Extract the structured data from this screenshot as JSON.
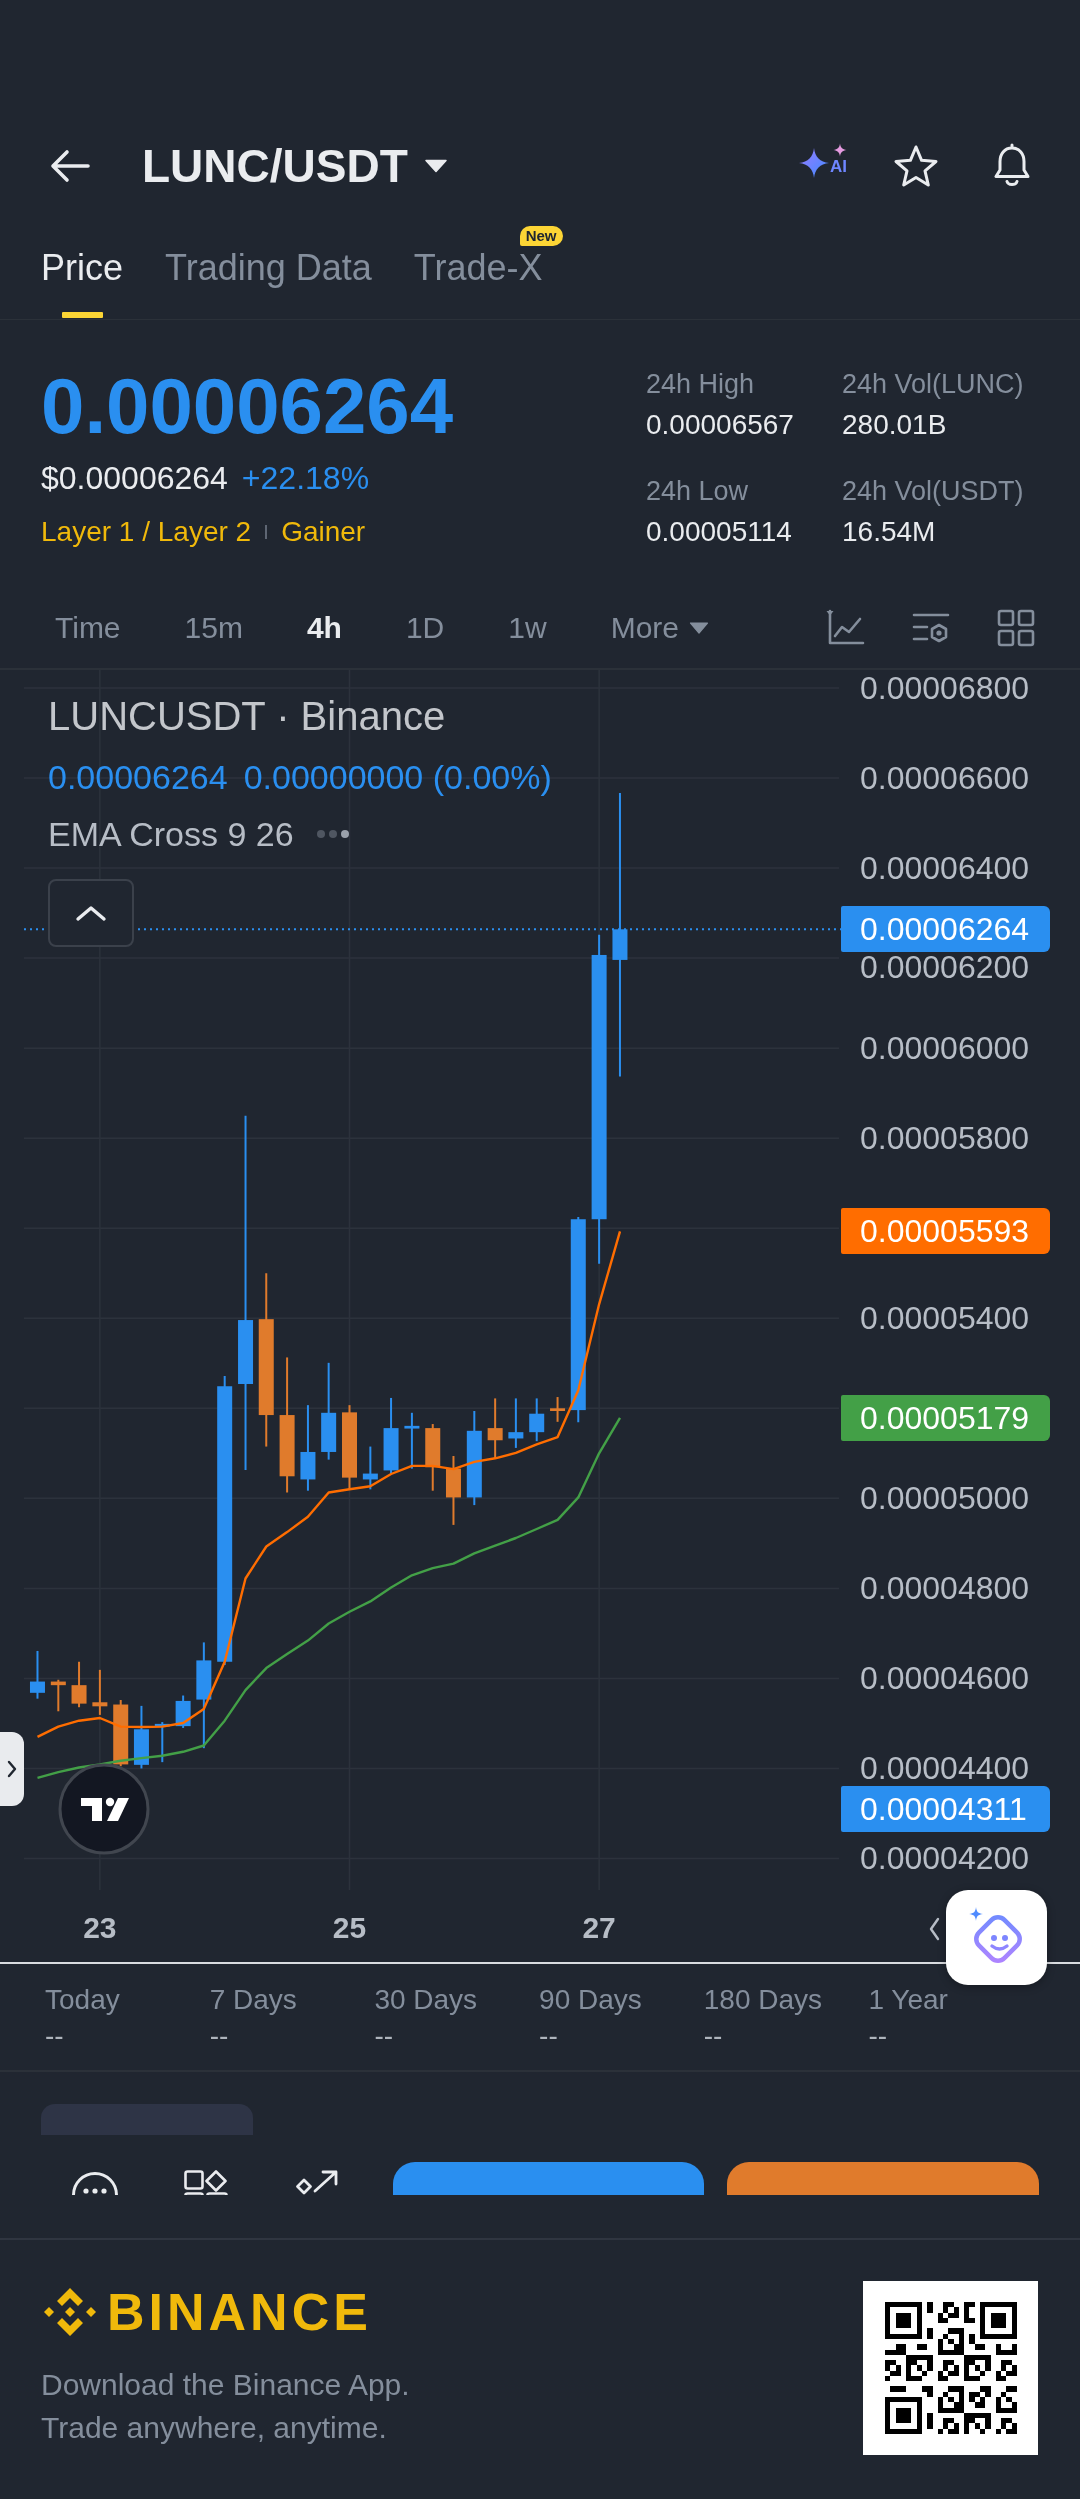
{
  "header": {
    "title": "LUNC/USDT",
    "ai_label": "AI"
  },
  "tabs": [
    {
      "label": "Price",
      "selected": true
    },
    {
      "label": "Trading Data",
      "selected": false
    },
    {
      "label": "Trade-X",
      "selected": false,
      "badge": "New"
    }
  ],
  "ticker": {
    "price": "0.00006264",
    "usd_price": "$0.00006264",
    "change": "+22.18%",
    "tags": [
      "Layer 1 / Layer 2",
      "Gainer"
    ],
    "stats": [
      {
        "label": "24h High",
        "value": "0.00006567"
      },
      {
        "label": "24h Vol(LUNC)",
        "value": "280.01B"
      },
      {
        "label": "24h Low",
        "value": "0.00005114"
      },
      {
        "label": "24h Vol(USDT)",
        "value": "16.54M"
      }
    ]
  },
  "intervals": [
    {
      "label": "Time",
      "kind": "option",
      "selected": false
    },
    {
      "label": "15m",
      "kind": "option",
      "selected": false
    },
    {
      "label": "4h",
      "kind": "option",
      "selected": true
    },
    {
      "label": "1D",
      "kind": "option",
      "selected": false
    },
    {
      "label": "1w",
      "kind": "option",
      "selected": false
    },
    {
      "label": "More",
      "kind": "menu",
      "selected": false
    }
  ],
  "chart": {
    "legend": {
      "symbol": "LUNCUSDT · Binance",
      "price": "0.00006264",
      "change": "0.00000000 (0.00%)",
      "indicator": "EMA Cross 9 26"
    },
    "chart_data": {
      "type": "candlestick",
      "x": [
        22.5,
        22.667,
        22.833,
        23,
        23.167,
        23.333,
        23.5,
        23.667,
        23.833,
        24,
        24.167,
        24.333,
        24.5,
        24.667,
        24.833,
        25,
        25.167,
        25.333,
        25.5,
        25.667,
        25.833,
        26,
        26.167,
        26.333,
        26.5,
        26.667,
        26.833,
        27,
        27.167
      ],
      "ohlc": [
        [
          4.568e-05,
          4.661e-05,
          4.555e-05,
          4.593e-05
        ],
        [
          4.593e-05,
          4.597e-05,
          4.527e-05,
          4.585e-05
        ],
        [
          4.585e-05,
          4.637e-05,
          4.536e-05,
          4.544e-05
        ],
        [
          4.547e-05,
          4.619e-05,
          4.519e-05,
          4.538e-05
        ],
        [
          4.542e-05,
          4.552e-05,
          4.405e-05,
          4.409e-05
        ],
        [
          4.408e-05,
          4.539e-05,
          4.4e-05,
          4.487e-05
        ],
        [
          4.493e-05,
          4.503e-05,
          4.414e-05,
          4.499e-05
        ],
        [
          4.494e-05,
          4.562e-05,
          4.49e-05,
          4.55e-05
        ],
        [
          4.553e-05,
          4.68e-05,
          4.445e-05,
          4.64e-05
        ],
        [
          4.637e-05,
          5.272e-05,
          4.63e-05,
          5.249e-05
        ],
        [
          5.254e-05,
          5.85e-05,
          5.063e-05,
          5.396e-05
        ],
        [
          5.398e-05,
          5.5e-05,
          5.115e-05,
          5.185e-05
        ],
        [
          5.185e-05,
          5.313e-05,
          5.013e-05,
          5.049e-05
        ],
        [
          5.042e-05,
          5.207e-05,
          5.017e-05,
          5.103e-05
        ],
        [
          5.103e-05,
          5.301e-05,
          5.086e-05,
          5.19e-05
        ],
        [
          5.191e-05,
          5.207e-05,
          5.02e-05,
          5.046e-05
        ],
        [
          5.042e-05,
          5.115e-05,
          5.02e-05,
          5.055e-05
        ],
        [
          5.062e-05,
          5.223e-05,
          5.055e-05,
          5.156e-05
        ],
        [
          5.155e-05,
          5.19e-05,
          5.066e-05,
          5.161e-05
        ],
        [
          5.156e-05,
          5.165e-05,
          5.017e-05,
          5.069e-05
        ],
        [
          5.066e-05,
          5.094e-05,
          4.941e-05,
          5.002e-05
        ],
        [
          5.002e-05,
          5.194e-05,
          4.985e-05,
          5.15e-05
        ],
        [
          5.156e-05,
          5.222e-05,
          5.089e-05,
          5.129e-05
        ],
        [
          5.133e-05,
          5.222e-05,
          5.112e-05,
          5.147e-05
        ],
        [
          5.147e-05,
          5.222e-05,
          5.127e-05,
          5.188e-05
        ],
        [
          5.2e-05,
          5.225e-05,
          5.17e-05,
          5.194e-05
        ],
        [
          5.196e-05,
          5.625e-05,
          5.169e-05,
          5.62e-05
        ],
        [
          5.62e-05,
          6.252e-05,
          5.521e-05,
          6.207e-05
        ],
        [
          6.196e-05,
          6.567e-05,
          5.937e-05,
          6.264e-05
        ]
      ],
      "xlim": [
        22.392,
        28.922
      ],
      "ylim": [
        4.13e-05,
        6.84e-05
      ],
      "grid": true,
      "xticks": [
        23,
        25,
        27
      ],
      "yticks": [
        {
          "value": 6.8e-05,
          "label": "0.00006800"
        },
        {
          "value": 6.6e-05,
          "label": "0.00006600"
        },
        {
          "value": 6.4e-05,
          "label": "0.00006400"
        },
        {
          "value": 6.2e-05,
          "label": "0.00006200"
        },
        {
          "value": 6e-05,
          "label": "0.00006000"
        },
        {
          "value": 5.8e-05,
          "label": "0.00005800"
        },
        {
          "value": 5.4e-05,
          "label": "0.00005400"
        },
        {
          "value": 5e-05,
          "label": "0.00005000"
        },
        {
          "value": 4.8e-05,
          "label": "0.00004800"
        },
        {
          "value": 4.6e-05,
          "label": "0.00004600"
        },
        {
          "value": 4.4e-05,
          "label": "0.00004400"
        },
        {
          "value": 4.2e-05,
          "label": "0.00004200"
        }
      ],
      "series": [
        {
          "type": "line",
          "color": "#ff6d00",
          "values": [
            4.47e-05,
            4.493e-05,
            4.506e-05,
            4.512e-05,
            4.493e-05,
            4.492e-05,
            4.493e-05,
            4.501e-05,
            4.532e-05,
            4.637e-05,
            4.822e-05,
            4.893e-05,
            4.925e-05,
            4.959e-05,
            5.013e-05,
            5.02e-05,
            5.027e-05,
            5.054e-05,
            5.072e-05,
            5.072e-05,
            5.065e-05,
            5.081e-05,
            5.089e-05,
            5.101e-05,
            5.12e-05,
            5.136e-05,
            5.24e-05,
            5.431e-05,
            5.593e-05
          ]
        },
        {
          "type": "line",
          "color": "#43a047",
          "values": [
            4.379e-05,
            4.392e-05,
            4.402e-05,
            4.409e-05,
            4.417e-05,
            4.423e-05,
            4.428e-05,
            4.437e-05,
            4.451e-05,
            4.506e-05,
            4.574e-05,
            4.623e-05,
            4.654e-05,
            4.684e-05,
            4.722e-05,
            4.748e-05,
            4.771e-05,
            4.802e-05,
            4.829e-05,
            4.845e-05,
            4.855e-05,
            4.878e-05,
            4.895e-05,
            4.912e-05,
            4.932e-05,
            4.952e-05,
            5.002e-05,
            5.1e-05,
            5.179e-05
          ]
        }
      ],
      "ref_lines": [
        {
          "axis": "y",
          "value": 6.264e-05,
          "label": "0.00006264"
        }
      ],
      "annotations": [
        "0.00005593",
        "0.00005179"
      ]
    },
    "price_marker": "0.00004311"
  },
  "periods": [
    {
      "label": "Today",
      "value": "--"
    },
    {
      "label": "7 Days",
      "value": "--"
    },
    {
      "label": "30 Days",
      "value": "--"
    },
    {
      "label": "90 Days",
      "value": "--"
    },
    {
      "label": "180 Days",
      "value": "--"
    },
    {
      "label": "1 Year",
      "value": "--"
    }
  ],
  "footer": {
    "brand": "BINANCE",
    "lines": [
      "Download the Binance App.",
      "Trade anywhere, anytime."
    ]
  }
}
